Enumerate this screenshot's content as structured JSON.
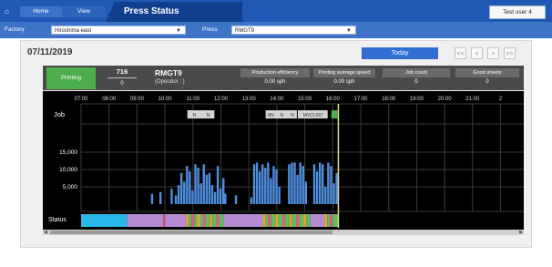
{
  "header": {
    "home_icon": "⌂",
    "home_label": "Home",
    "view_label": "View",
    "title": "Press Status",
    "user_button": "Test user 4"
  },
  "filters": {
    "factory_label": "Factory",
    "factory_value": "Hiroshima east",
    "press_label": "Press",
    "press_value": "RMGT9"
  },
  "date": "07/11/2019",
  "nav": {
    "today": "Today",
    "first": "<<",
    "prev": "<",
    "next": ">",
    "last": ">>"
  },
  "status": {
    "state": "Printing",
    "count": "716",
    "count_sub": "0",
    "press": "RMGT9",
    "operator": "(Operator : )",
    "metrics": [
      {
        "label": "Production efficiency",
        "value": "0.00 sph"
      },
      {
        "label": "Printing average speed",
        "value": "0.00 sph"
      },
      {
        "label": "Job count",
        "value": "0"
      },
      {
        "label": "Good sheets",
        "value": "0"
      }
    ]
  },
  "chart_data": {
    "type": "bar",
    "title": "",
    "x_ticks": [
      "07:00",
      "08:00",
      "09:00",
      "10:00",
      "11:00",
      "12:00",
      "13:00",
      "14:00",
      "15:00",
      "16:00",
      "17:00",
      "18:00",
      "19:00",
      "20:00",
      "21:00",
      "2"
    ],
    "y_ticks": [
      "15,000",
      "10,000",
      "5,000"
    ],
    "row_labels": {
      "job": "Job",
      "status": "Status"
    },
    "ylim": [
      0,
      20000
    ],
    "jobs": [
      {
        "start": 10.8,
        "end": 11.8,
        "labels": [
          "N",
          "N"
        ]
      },
      {
        "start": 13.6,
        "end": 14.75,
        "labels": [
          "8N",
          "N",
          "N"
        ]
      },
      {
        "start": 14.75,
        "end": 15.85,
        "labels": [
          "MVCL097"
        ]
      },
      {
        "start": 15.95,
        "end": 16.2,
        "labels": [],
        "color": "#4cae4c"
      }
    ],
    "speed_bars": [
      {
        "x": 9.5,
        "v": 3000
      },
      {
        "x": 9.8,
        "v": 3500
      },
      {
        "x": 10.2,
        "v": 4500
      },
      {
        "x": 10.35,
        "v": 2500
      },
      {
        "x": 10.45,
        "v": 5500
      },
      {
        "x": 10.55,
        "v": 9000
      },
      {
        "x": 10.65,
        "v": 6500
      },
      {
        "x": 10.75,
        "v": 11000
      },
      {
        "x": 10.85,
        "v": 9500
      },
      {
        "x": 10.95,
        "v": 4000
      },
      {
        "x": 11.05,
        "v": 11500
      },
      {
        "x": 11.15,
        "v": 10500
      },
      {
        "x": 11.25,
        "v": 6000
      },
      {
        "x": 11.35,
        "v": 11500
      },
      {
        "x": 11.45,
        "v": 8500
      },
      {
        "x": 11.55,
        "v": 9000
      },
      {
        "x": 11.65,
        "v": 5500
      },
      {
        "x": 11.75,
        "v": 3500
      },
      {
        "x": 11.85,
        "v": 11000
      },
      {
        "x": 11.95,
        "v": 4500
      },
      {
        "x": 12.05,
        "v": 7500
      },
      {
        "x": 12.12,
        "v": 3000
      },
      {
        "x": 12.5,
        "v": 2500
      },
      {
        "x": 13.05,
        "v": 2000
      },
      {
        "x": 13.15,
        "v": 11500
      },
      {
        "x": 13.25,
        "v": 12000
      },
      {
        "x": 13.35,
        "v": 9500
      },
      {
        "x": 13.45,
        "v": 11500
      },
      {
        "x": 13.55,
        "v": 10500
      },
      {
        "x": 13.65,
        "v": 12000
      },
      {
        "x": 13.75,
        "v": 7500
      },
      {
        "x": 13.85,
        "v": 11000
      },
      {
        "x": 13.95,
        "v": 10000
      },
      {
        "x": 14.05,
        "v": 5000
      },
      {
        "x": 14.4,
        "v": 11500
      },
      {
        "x": 14.5,
        "v": 12000
      },
      {
        "x": 14.6,
        "v": 12000
      },
      {
        "x": 14.7,
        "v": 8500
      },
      {
        "x": 14.8,
        "v": 12000
      },
      {
        "x": 14.9,
        "v": 11000
      },
      {
        "x": 15.0,
        "v": 6500
      },
      {
        "x": 15.3,
        "v": 11500
      },
      {
        "x": 15.4,
        "v": 9500
      },
      {
        "x": 15.5,
        "v": 12000
      },
      {
        "x": 15.6,
        "v": 11500
      },
      {
        "x": 15.7,
        "v": 5000
      },
      {
        "x": 15.8,
        "v": 12000
      },
      {
        "x": 15.9,
        "v": 11000
      },
      {
        "x": 16.0,
        "v": 6000
      },
      {
        "x": 16.1,
        "v": 9000
      }
    ],
    "status_segments": [
      {
        "start": 7.0,
        "end": 8.65,
        "color": "#29b6e8"
      },
      {
        "start": 8.65,
        "end": 9.95,
        "color": "#b58ad1"
      },
      {
        "start": 9.95,
        "end": 10.0,
        "color": "#d94040"
      },
      {
        "start": 10.0,
        "end": 10.75,
        "color": "#b58ad1"
      },
      {
        "start": 10.75,
        "end": 10.85,
        "color": "#e8a23c"
      },
      {
        "start": 10.85,
        "end": 10.95,
        "color": "#5cbf5c"
      },
      {
        "start": 10.95,
        "end": 11.05,
        "color": "#e85a8a"
      },
      {
        "start": 11.05,
        "end": 11.15,
        "color": "#5cbf5c"
      },
      {
        "start": 11.15,
        "end": 11.25,
        "color": "#e8a23c"
      },
      {
        "start": 11.25,
        "end": 11.35,
        "color": "#5cbf5c"
      },
      {
        "start": 11.35,
        "end": 11.45,
        "color": "#e85a8a"
      },
      {
        "start": 11.45,
        "end": 11.6,
        "color": "#5cbf5c"
      },
      {
        "start": 11.6,
        "end": 11.7,
        "color": "#e8a23c"
      },
      {
        "start": 11.7,
        "end": 11.85,
        "color": "#5cbf5c"
      },
      {
        "start": 11.85,
        "end": 11.95,
        "color": "#e85a8a"
      },
      {
        "start": 11.95,
        "end": 12.1,
        "color": "#5cbf5c"
      },
      {
        "start": 12.1,
        "end": 13.5,
        "color": "#b58ad1"
      },
      {
        "start": 13.5,
        "end": 13.6,
        "color": "#e8a23c"
      },
      {
        "start": 13.6,
        "end": 13.7,
        "color": "#5cbf5c"
      },
      {
        "start": 13.7,
        "end": 13.8,
        "color": "#e85a8a"
      },
      {
        "start": 13.8,
        "end": 13.95,
        "color": "#5cbf5c"
      },
      {
        "start": 13.95,
        "end": 14.05,
        "color": "#e8a23c"
      },
      {
        "start": 14.05,
        "end": 14.2,
        "color": "#5cbf5c"
      },
      {
        "start": 14.2,
        "end": 14.3,
        "color": "#e85a8a"
      },
      {
        "start": 14.3,
        "end": 14.45,
        "color": "#5cbf5c"
      },
      {
        "start": 14.45,
        "end": 14.55,
        "color": "#e8a23c"
      },
      {
        "start": 14.55,
        "end": 14.7,
        "color": "#5cbf5c"
      },
      {
        "start": 14.7,
        "end": 14.8,
        "color": "#e85a8a"
      },
      {
        "start": 14.8,
        "end": 14.95,
        "color": "#5cbf5c"
      },
      {
        "start": 14.95,
        "end": 15.05,
        "color": "#e8a23c"
      },
      {
        "start": 15.05,
        "end": 15.2,
        "color": "#5cbf5c"
      },
      {
        "start": 15.2,
        "end": 15.7,
        "color": "#b58ad1"
      },
      {
        "start": 15.7,
        "end": 15.8,
        "color": "#e8a23c"
      },
      {
        "start": 15.8,
        "end": 15.9,
        "color": "#5cbf5c"
      },
      {
        "start": 15.9,
        "end": 16.0,
        "color": "#e85a8a"
      },
      {
        "start": 16.0,
        "end": 16.2,
        "color": "#5cbf5c"
      }
    ],
    "current_time": 16.2,
    "colors": {
      "bar": "#4f8fe0",
      "grid": "#3a3a3a",
      "job_box": "#d4d4d4",
      "now_line": "#e8e090"
    }
  }
}
